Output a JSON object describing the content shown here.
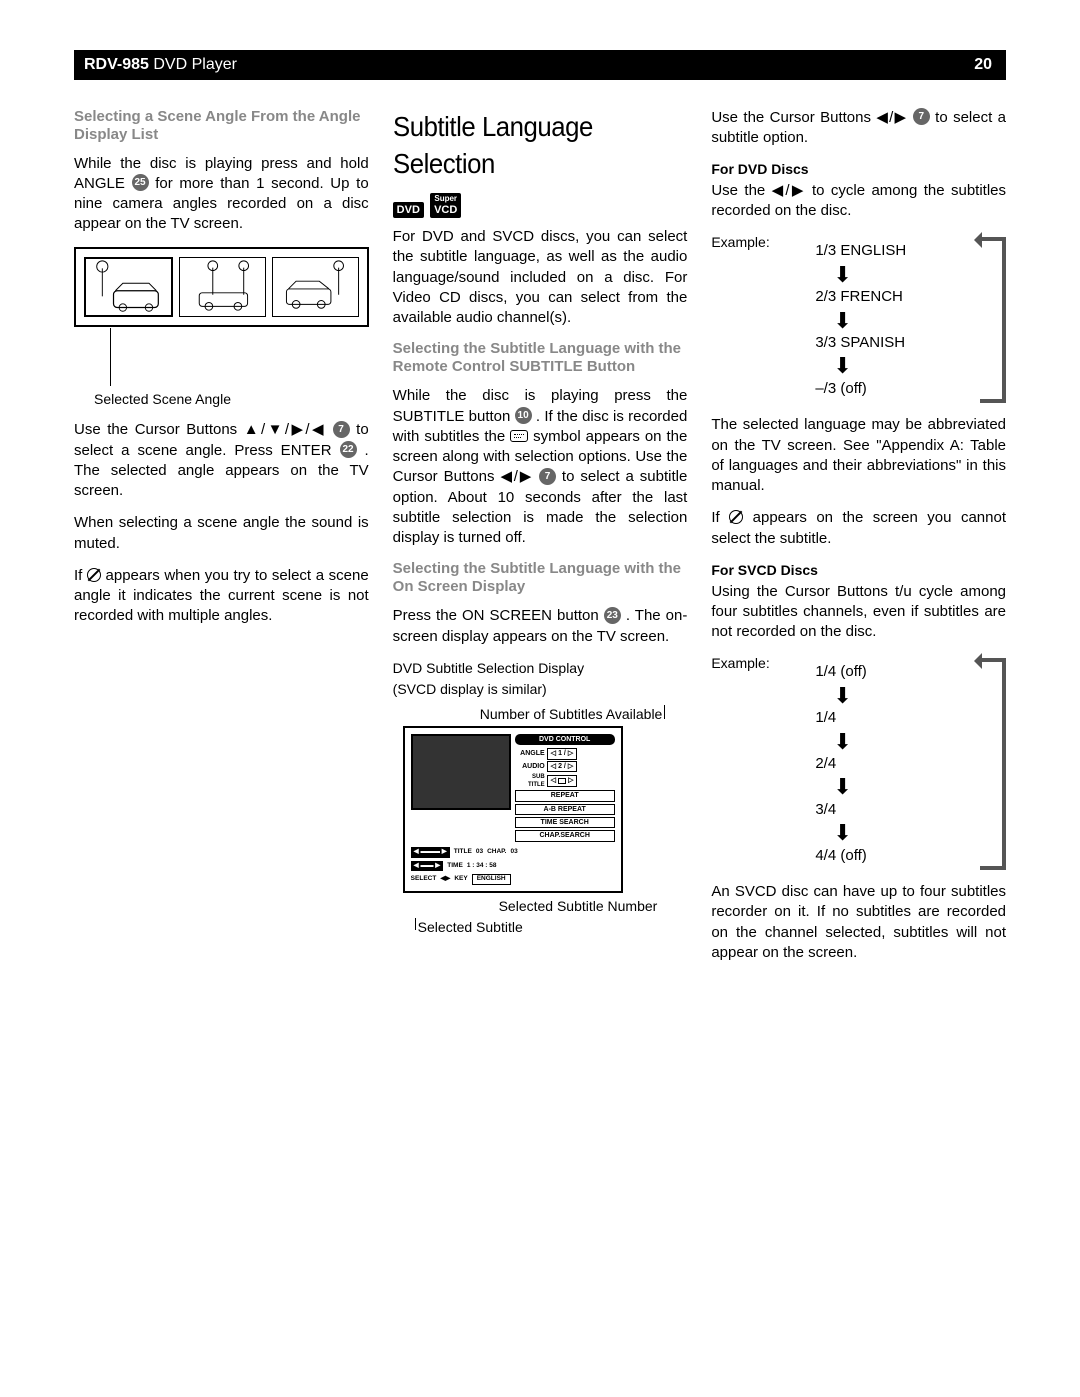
{
  "header": {
    "model": "RDV-985",
    "product": "DVD Player",
    "page": "20"
  },
  "col1": {
    "h": "Selecting a Scene Angle From the Angle Display List",
    "p1a": "While the disc is playing press and hold ANGLE ",
    "p1b": " for more than 1 second. Up to nine camera angles recorded on a disc appear on the TV screen.",
    "ref25": "25",
    "scene_caption": "Selected Scene Angle",
    "p2a": "Use the Cursor Buttons ▲/▼/▶/◀ ",
    "p2b": " to select a scene angle. Press ENTER ",
    "p2c": ". The selected angle appears on the TV screen.",
    "ref7": "7",
    "ref22": "22",
    "p3": "When selecting a scene angle the sound is muted.",
    "p4a": "If ",
    "p4b": " appears when you try to select a scene angle it indicates the current scene is not recorded with multiple angles."
  },
  "col2": {
    "title": "Subtitle Language Selection",
    "badge_dvd": "DVD",
    "badge_super": "Super",
    "badge_vcd": "VCD",
    "intro": "For DVD and SVCD discs, you can select the subtitle language, as well as the audio language/sound included on a disc. For Video CD discs, you can select from the available audio channel(s).",
    "h2": "Selecting the Subtitle Language with the Remote Control SUBTITLE Button",
    "p_rc_a": "While the disc is playing press the SUBTITLE button ",
    "p_rc_b": ". If the disc is recorded with subtitles the ",
    "p_rc_c": " symbol appears on the screen along with selection options. Use the Cursor Buttons ◀/▶ ",
    "p_rc_d": " to select a subtitle option. About 10 seconds after the last subtitle selection is made the selection display is turned off.",
    "ref10": "10",
    "ref7": "7",
    "h3": "Selecting the Subtitle Language with the On Screen Display",
    "p_osd_a": "Press the ON SCREEN button ",
    "p_osd_b": ". The on-screen display appears on the TV screen.",
    "ref23": "23",
    "osd_cap1": "DVD Subtitle Selection Display",
    "osd_cap2": "(SVCD display is similar)",
    "osd_callout_top": "Number of Subtitles Available",
    "osd": {
      "hdr": "DVD CONTROL",
      "angle_l": "ANGLE",
      "angle_v": "1 /",
      "audio_l": "AUDIO",
      "audio_v": "2 /",
      "sub_l": "SUB TITLE",
      "repeat": "REPEAT",
      "abrepeat": "A-B REPEAT",
      "timesearch": "TIME SEARCH",
      "chapsearch": "CHAP.SEARCH",
      "title_l": "TITLE",
      "title_v": "03",
      "chap_l": "CHAP.",
      "chap_v": "03",
      "time_l": "TIME",
      "time_v": "1 : 34 : 58",
      "select": "SELECT",
      "key": "KEY",
      "lang": "ENGLISH"
    },
    "osd_callout_b1": "Selected Subtitle Number",
    "osd_callout_b2": "Selected Subtitle"
  },
  "col3": {
    "p_top_a": "Use the Cursor Buttons ◀/▶ ",
    "p_top_b": " to select a subtitle option.",
    "ref7": "7",
    "h_dvd": "For DVD Discs",
    "p_dvd": "Use the ◀/▶ to cycle among the subtitles recorded on the disc.",
    "example": "Example:",
    "dvd_cycle": [
      "1/3 ENGLISH",
      "2/3 FRENCH",
      "3/3 SPANISH",
      "–/3 (off)"
    ],
    "p_abbrev": "The selected language may be abbreviated on the TV screen. See \"Appendix A: Table of languages and their abbreviations\" in this manual.",
    "p_no_a": "If ",
    "p_no_b": " appears on the screen you cannot select the subtitle.",
    "h_svcd": "For SVCD Discs",
    "p_svcd": "Using the Cursor Buttons t/u cycle among four subtitles channels, even if subtitles are not recorded on the disc.",
    "svcd_cycle": [
      "1/4 (off)",
      "1/4",
      "2/4",
      "3/4",
      "4/4 (off)"
    ],
    "p_svcd2": "An SVCD disc can have up to four subtitles recorder on it. If no subtitles are recorded on the channel selected, subtitles will not appear on the screen."
  }
}
